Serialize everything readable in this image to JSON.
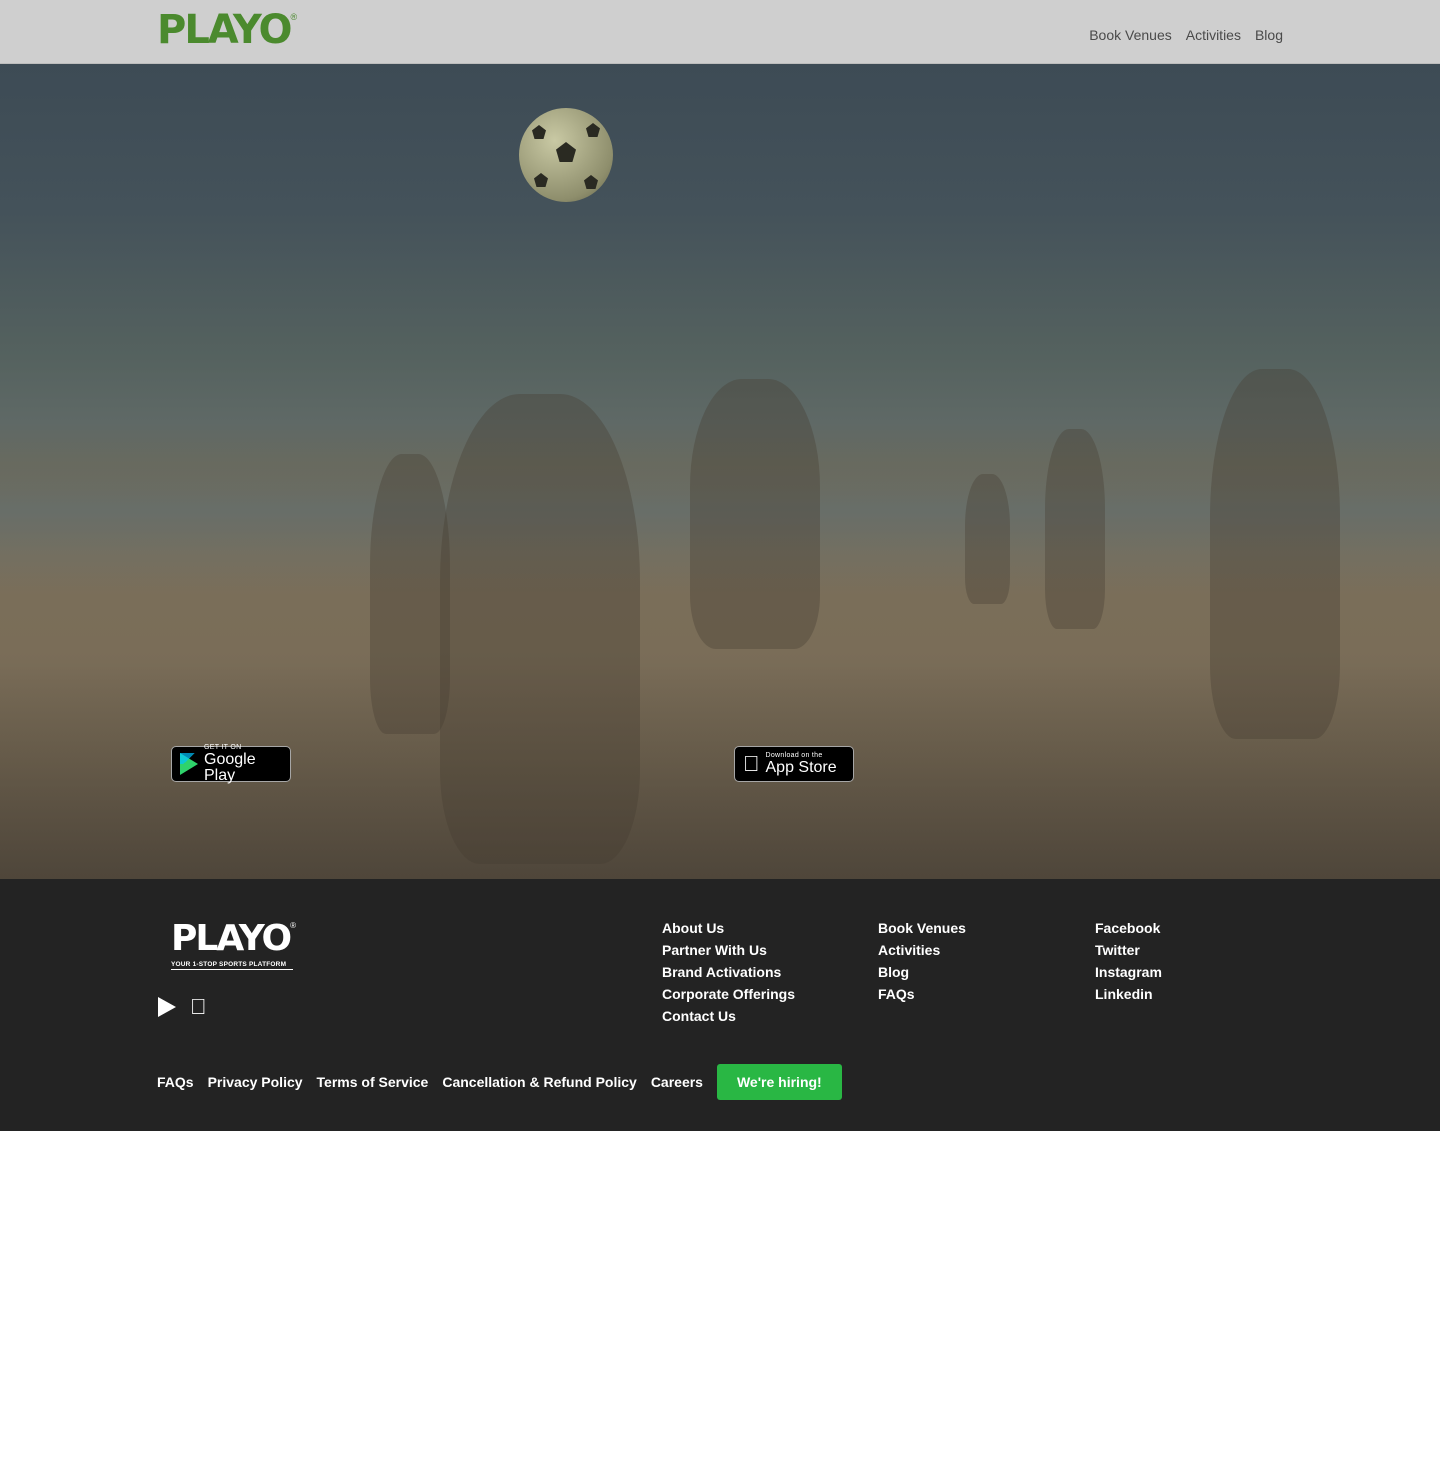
{
  "header": {
    "logo_text": "PLAYO",
    "nav": [
      "Book Venues",
      "Activities",
      "Blog"
    ]
  },
  "hero": {
    "google_play": {
      "small": "GET IT ON",
      "big": "Google Play"
    },
    "app_store": {
      "small": "Download on the",
      "big": "App Store"
    }
  },
  "footer": {
    "logo_text": "PLAYO",
    "tagline": "YOUR 1-STOP SPORTS PLATFORM",
    "col1": [
      "About Us",
      "Partner With Us",
      "Brand Activations",
      "Corporate Offerings",
      "Contact Us"
    ],
    "col2": [
      "Book Venues",
      "Activities",
      "Blog",
      "FAQs"
    ],
    "col3": [
      "Facebook",
      "Twitter",
      "Instagram",
      "Linkedin"
    ],
    "bottom_links": [
      "FAQs",
      "Privacy Policy",
      "Terms of Service",
      "Cancellation & Refund Policy",
      "Careers"
    ],
    "hiring_label": "We're hiring!"
  },
  "colors": {
    "brand_green": "#4b8a2e",
    "hire_green": "#29b744",
    "footer_bg": "#232323",
    "header_bg": "#cfcfcf"
  },
  "icons": [
    "tennis-ball-icon",
    "google-play-icon",
    "apple-icon"
  ]
}
